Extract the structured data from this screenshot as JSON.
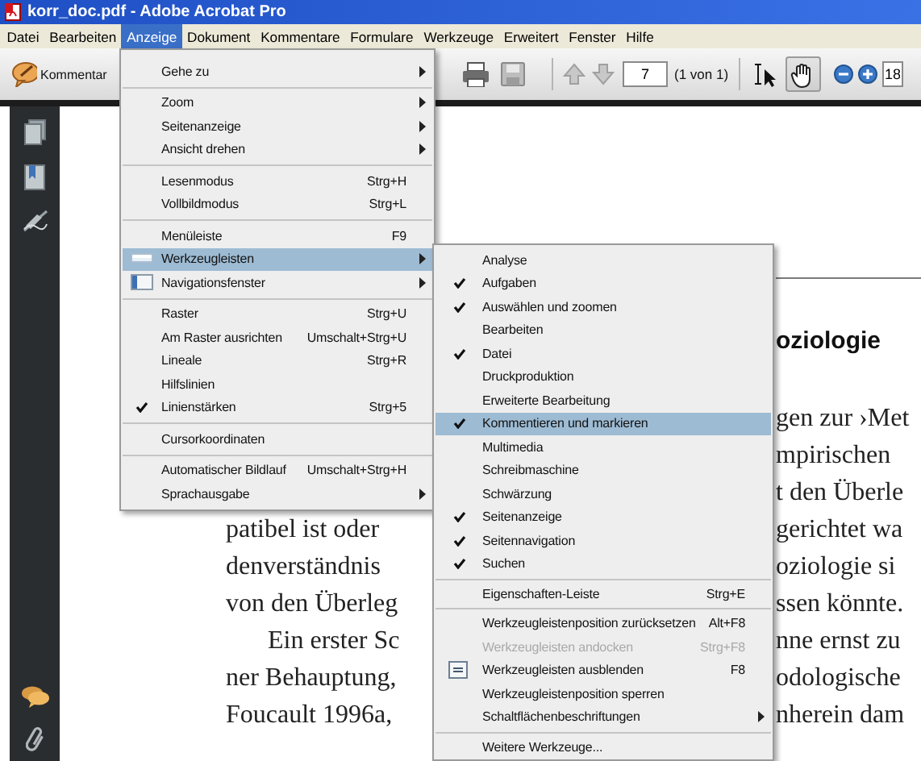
{
  "window": {
    "title": "korr_doc.pdf - Adobe Acrobat Pro"
  },
  "menubar": [
    {
      "label": "Datei",
      "selected": false
    },
    {
      "label": "Bearbeiten",
      "selected": false
    },
    {
      "label": "Anzeige",
      "selected": true
    },
    {
      "label": "Dokument",
      "selected": false
    },
    {
      "label": "Kommentare",
      "selected": false
    },
    {
      "label": "Formulare",
      "selected": false
    },
    {
      "label": "Werkzeuge",
      "selected": false
    },
    {
      "label": "Erweitert",
      "selected": false
    },
    {
      "label": "Fenster",
      "selected": false
    },
    {
      "label": "Hilfe",
      "selected": false
    }
  ],
  "toolbar": {
    "comment_button": "Kommentar",
    "page_field": "7",
    "page_count": "(1 von 1)",
    "zoom_field": "18",
    "tools": [
      {
        "kind": "select",
        "selected": false
      },
      {
        "kind": "hand",
        "selected": true
      }
    ]
  },
  "view_menu": {
    "items": [
      {
        "kind": "item",
        "label": "Gehe zu",
        "submenu": true,
        "checked": false,
        "selected": false
      },
      {
        "kind": "separator"
      },
      {
        "kind": "item",
        "label": "Zoom",
        "submenu": true,
        "checked": false,
        "selected": false
      },
      {
        "kind": "item",
        "label": "Seitenanzeige",
        "submenu": true,
        "checked": false,
        "selected": false
      },
      {
        "kind": "item",
        "label": "Ansicht drehen",
        "submenu": true,
        "checked": false,
        "selected": false
      },
      {
        "kind": "separator"
      },
      {
        "kind": "item",
        "label": "Lesenmodus",
        "shortcut": "Strg+H",
        "submenu": false,
        "checked": false,
        "selected": false
      },
      {
        "kind": "item",
        "label": "Vollbildmodus",
        "shortcut": "Strg+L",
        "submenu": false,
        "checked": false,
        "selected": false
      },
      {
        "kind": "separator"
      },
      {
        "kind": "item",
        "label": "Menüleiste",
        "shortcut": "F9",
        "submenu": false,
        "checked": false,
        "selected": false
      },
      {
        "kind": "toolbars",
        "label": "Werkzeugleisten",
        "submenu": true,
        "checked": false,
        "selected": true
      },
      {
        "kind": "navpanel",
        "label": "Navigationsfenster",
        "submenu": true,
        "checked": false,
        "selected": false
      },
      {
        "kind": "separator"
      },
      {
        "kind": "item",
        "label": "Raster",
        "shortcut": "Strg+U",
        "submenu": false,
        "checked": false,
        "selected": false
      },
      {
        "kind": "item",
        "label": "Am Raster ausrichten",
        "shortcut": "Umschalt+Strg+U",
        "submenu": false,
        "checked": false,
        "selected": false
      },
      {
        "kind": "item",
        "label": "Lineale",
        "shortcut": "Strg+R",
        "submenu": false,
        "checked": false,
        "selected": false
      },
      {
        "kind": "item",
        "label": "Hilfslinien",
        "submenu": false,
        "checked": false,
        "selected": false
      },
      {
        "kind": "item",
        "label": "Linienstärken",
        "shortcut": "Strg+5",
        "submenu": false,
        "checked": true,
        "selected": false
      },
      {
        "kind": "separator"
      },
      {
        "kind": "item",
        "label": "Cursorkoordinaten",
        "submenu": false,
        "checked": false,
        "selected": false
      },
      {
        "kind": "separator"
      },
      {
        "kind": "item",
        "label": "Automatischer Bildlauf",
        "shortcut": "Umschalt+Strg+H",
        "submenu": false,
        "checked": false,
        "selected": false
      },
      {
        "kind": "item",
        "label": "Sprachausgabe",
        "submenu": true,
        "checked": false,
        "selected": false
      }
    ]
  },
  "toolbars_submenu": {
    "items": [
      {
        "kind": "item",
        "label": "Analyse",
        "submenu": false,
        "checked": false,
        "selected": false,
        "disabled": false
      },
      {
        "kind": "item",
        "label": "Aufgaben",
        "submenu": false,
        "checked": true,
        "selected": false,
        "disabled": false
      },
      {
        "kind": "item",
        "label": "Auswählen und zoomen",
        "submenu": false,
        "checked": true,
        "selected": false,
        "disabled": false
      },
      {
        "kind": "item",
        "label": "Bearbeiten",
        "submenu": false,
        "checked": false,
        "selected": false,
        "disabled": false
      },
      {
        "kind": "item",
        "label": "Datei",
        "submenu": false,
        "checked": true,
        "selected": false,
        "disabled": false
      },
      {
        "kind": "item",
        "label": "Druckproduktion",
        "submenu": false,
        "checked": false,
        "selected": false,
        "disabled": false
      },
      {
        "kind": "item",
        "label": "Erweiterte Bearbeitung",
        "submenu": false,
        "checked": false,
        "selected": false,
        "disabled": false
      },
      {
        "kind": "item",
        "label": "Kommentieren und markieren",
        "submenu": false,
        "checked": true,
        "selected": true,
        "disabled": false
      },
      {
        "kind": "item",
        "label": "Multimedia",
        "submenu": false,
        "checked": false,
        "selected": false,
        "disabled": false
      },
      {
        "kind": "item",
        "label": "Schreibmaschine",
        "submenu": false,
        "checked": false,
        "selected": false,
        "disabled": false
      },
      {
        "kind": "item",
        "label": "Schwärzung",
        "submenu": false,
        "checked": false,
        "selected": false,
        "disabled": false
      },
      {
        "kind": "item",
        "label": "Seitenanzeige",
        "submenu": false,
        "checked": true,
        "selected": false,
        "disabled": false
      },
      {
        "kind": "item",
        "label": "Seitennavigation",
        "submenu": false,
        "checked": true,
        "selected": false,
        "disabled": false
      },
      {
        "kind": "item",
        "label": "Suchen",
        "submenu": false,
        "checked": true,
        "selected": false,
        "disabled": false
      },
      {
        "kind": "separator"
      },
      {
        "kind": "item",
        "label": "Eigenschaften-Leiste",
        "shortcut": "Strg+E",
        "submenu": false,
        "checked": false,
        "selected": false,
        "disabled": false
      },
      {
        "kind": "separator"
      },
      {
        "kind": "item",
        "label": "Werkzeugleistenposition zurücksetzen",
        "shortcut": "Alt+F8",
        "submenu": false,
        "checked": false,
        "selected": false,
        "disabled": false
      },
      {
        "kind": "item",
        "label": "Werkzeugleisten andocken",
        "shortcut": "Strg+F8",
        "submenu": false,
        "checked": false,
        "selected": false,
        "disabled": true
      },
      {
        "kind": "hidebar",
        "label": "Werkzeugleisten ausblenden",
        "shortcut": "F8",
        "submenu": false,
        "checked": false,
        "selected": false,
        "disabled": false
      },
      {
        "kind": "item",
        "label": "Werkzeugleistenposition sperren",
        "submenu": false,
        "checked": false,
        "selected": false,
        "disabled": false
      },
      {
        "kind": "item",
        "label": "Schaltflächenbeschriftungen",
        "submenu": true,
        "checked": false,
        "selected": false,
        "disabled": false
      },
      {
        "kind": "separator"
      },
      {
        "kind": "item",
        "label": "Weitere Werkzeuge...",
        "submenu": false,
        "checked": false,
        "selected": false,
        "disabled": false
      }
    ]
  },
  "document": {
    "heading": "oziologie",
    "lines": [
      {
        "kind": "line",
        "right": "gen zur ›Met"
      },
      {
        "kind": "line",
        "right": "mpirischen"
      },
      {
        "kind": "line",
        "right": "t den Überle"
      },
      {
        "kind": "line",
        "left": "patibel ist oder",
        "right": "gerichtet wa"
      },
      {
        "kind": "line",
        "left": "denverständnis",
        "right": "oziologie si"
      },
      {
        "kind": "line",
        "left": "von den Überleg",
        "right": "ssen könnte."
      },
      {
        "kind": "indented",
        "left": "Ein erster Sc",
        "right": "nne ernst zu"
      },
      {
        "kind": "line",
        "left": "ner Behauptung,",
        "right": "odologische"
      },
      {
        "kind": "line",
        "left": "Foucault 1996a,",
        "right": "nherein dam"
      }
    ]
  }
}
